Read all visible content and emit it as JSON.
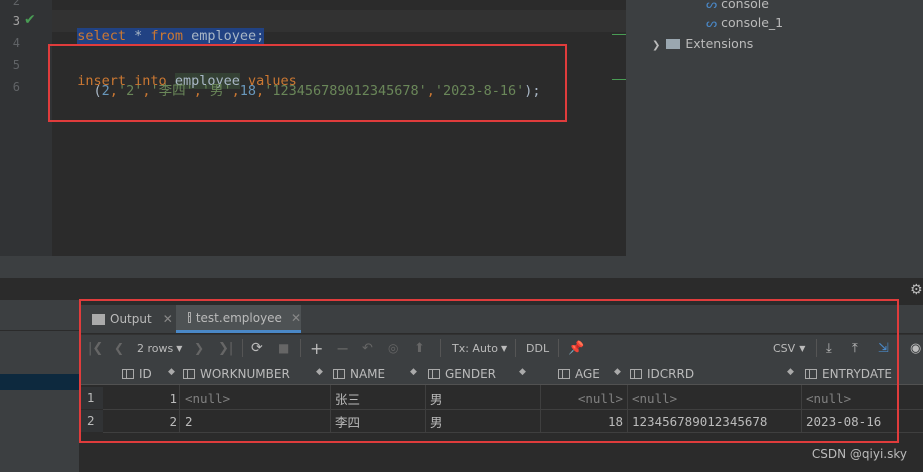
{
  "editor": {
    "lines": [
      "2",
      "3",
      "4",
      "5",
      "6"
    ],
    "select_kw": "select",
    "select_star": " * ",
    "select_from": "from",
    "select_table": " employee;",
    "insert_kw": "insert into",
    "insert_table": "employee",
    "insert_values": "values",
    "values_open": "(",
    "v1": "2",
    "v2": "'2'",
    "v3": "'李四'",
    "v4": "'男'",
    "v5": "18",
    "v6": "'123456789012345678'",
    "v7": "'2023-8-16'",
    "values_close": ");",
    "comma": ","
  },
  "tree": {
    "items": [
      "console",
      "console_1",
      "Extensions"
    ]
  },
  "tabs": [
    {
      "label": "Output"
    },
    {
      "label": "test.employee"
    }
  ],
  "toolbar": {
    "rows_label": "2 rows",
    "tx_label": "Tx: Auto",
    "ddl_label": "DDL",
    "csv_label": "CSV"
  },
  "table": {
    "columns": [
      "ID",
      "WORKNUMBER",
      "NAME",
      "GENDER",
      "AGE",
      "IDCRRD",
      "ENTRYDATE"
    ],
    "rows": [
      {
        "num": "1",
        "id": "1",
        "worknumber": "<null>",
        "name": "张三",
        "gender": "男",
        "age": "<null>",
        "idcard": "<null>",
        "entrydate": "<null>"
      },
      {
        "num": "2",
        "id": "2",
        "worknumber": "2",
        "name": "李四",
        "gender": "男",
        "age": "18",
        "idcard": "123456789012345678",
        "entrydate": "2023-08-16"
      }
    ]
  },
  "watermark": "CSDN @qiyi.sky",
  "colors": {
    "highlight_box": "#e03c3c",
    "keyword": "#cc7832",
    "string": "#6a8759",
    "number": "#6897bb"
  }
}
